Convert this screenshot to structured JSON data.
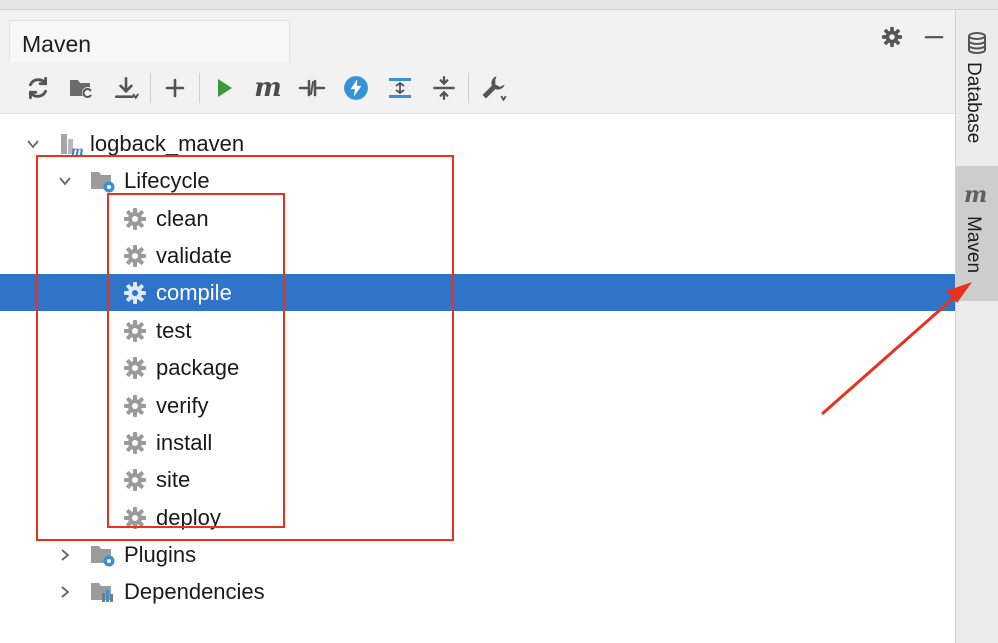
{
  "panel": {
    "title": "Maven"
  },
  "toolbar": {
    "buttons": [
      {
        "name": "reload-all-projects-button",
        "icon": "refresh-icon"
      },
      {
        "name": "generate-sources-button",
        "icon": "folder-refresh-icon"
      },
      {
        "name": "download-sources-button",
        "icon": "download-icon"
      },
      {
        "name": "add-maven-project-button",
        "icon": "plus-icon"
      },
      {
        "name": "run-maven-build-button",
        "icon": "play-icon"
      },
      {
        "name": "execute-maven-goal-button",
        "icon": "maven-m-icon",
        "text": "m"
      },
      {
        "name": "toggle-offline-mode-button",
        "icon": "offline-icon"
      },
      {
        "name": "skip-tests-button",
        "icon": "lightning-icon"
      },
      {
        "name": "show-dependencies-button",
        "icon": "dependency-diagram-icon"
      },
      {
        "name": "collapse-all-button",
        "icon": "collapse-icon"
      },
      {
        "name": "maven-settings-button",
        "icon": "wrench-icon"
      }
    ]
  },
  "tree": {
    "project": "logback_maven",
    "lifecycle_label": "Lifecycle",
    "lifecycle": [
      "clean",
      "validate",
      "compile",
      "test",
      "package",
      "verify",
      "install",
      "site",
      "deploy"
    ],
    "selected": "compile",
    "plugins_label": "Plugins",
    "dependencies_label": "Dependencies"
  },
  "side_tabs": {
    "database": "Database",
    "maven": "Maven",
    "maven_icon_text": "m"
  },
  "colors": {
    "selection": "#2f74c9",
    "annotation": "#e8321e",
    "run_green": "#3a9a3a",
    "skip_blue": "#3592d6",
    "maven_blue": "#3d7ec4"
  }
}
